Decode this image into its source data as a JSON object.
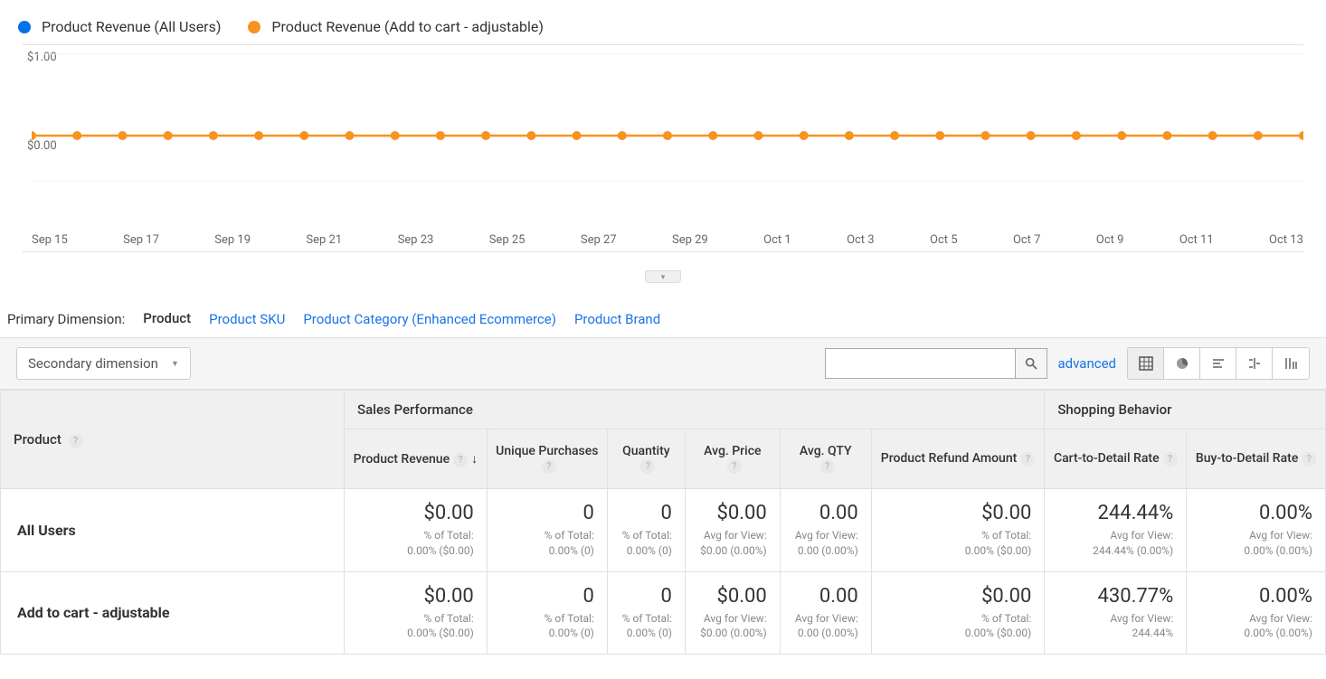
{
  "chart_data": {
    "type": "line",
    "series": [
      {
        "name": "Product Revenue (All Users)",
        "color": "#0073e6",
        "values": [
          0,
          0,
          0,
          0,
          0,
          0,
          0,
          0,
          0,
          0,
          0,
          0,
          0,
          0,
          0,
          0,
          0,
          0,
          0,
          0,
          0,
          0,
          0,
          0,
          0,
          0,
          0,
          0,
          0
        ]
      },
      {
        "name": "Product Revenue (Add to cart - adjustable)",
        "color": "#f7931e",
        "values": [
          0,
          0,
          0,
          0,
          0,
          0,
          0,
          0,
          0,
          0,
          0,
          0,
          0,
          0,
          0,
          0,
          0,
          0,
          0,
          0,
          0,
          0,
          0,
          0,
          0,
          0,
          0,
          0,
          0
        ]
      }
    ],
    "x_ticks": [
      "Sep 15",
      "Sep 17",
      "Sep 19",
      "Sep 21",
      "Sep 23",
      "Sep 25",
      "Sep 27",
      "Sep 29",
      "Oct 1",
      "Oct 3",
      "Oct 5",
      "Oct 7",
      "Oct 9",
      "Oct 11",
      "Oct 13"
    ],
    "y_ticks": [
      "$1.00",
      "$0.00"
    ],
    "ylim": [
      0,
      1
    ]
  },
  "dimension": {
    "label": "Primary Dimension:",
    "active": "Product",
    "links": [
      "Product SKU",
      "Product Category (Enhanced Ecommerce)",
      "Product Brand"
    ]
  },
  "controls": {
    "secondary": "Secondary dimension",
    "advanced": "advanced"
  },
  "table": {
    "product_header": "Product",
    "group1": "Sales Performance",
    "group2": "Shopping Behavior",
    "cols": [
      {
        "label": "Product Revenue",
        "sort": true
      },
      {
        "label": "Unique Purchases"
      },
      {
        "label": "Quantity"
      },
      {
        "label": "Avg. Price"
      },
      {
        "label": "Avg. QTY"
      },
      {
        "label": "Product Refund Amount"
      },
      {
        "label": "Cart-to-Detail Rate"
      },
      {
        "label": "Buy-to-Detail Rate"
      }
    ],
    "rows": [
      {
        "name": "All Users",
        "metrics": [
          {
            "v": "$0.00",
            "s1": "% of Total:",
            "s2": "0.00% ($0.00)"
          },
          {
            "v": "0",
            "s1": "% of Total:",
            "s2": "0.00% (0)"
          },
          {
            "v": "0",
            "s1": "% of Total:",
            "s2": "0.00% (0)"
          },
          {
            "v": "$0.00",
            "s1": "Avg for View:",
            "s2": "$0.00 (0.00%)"
          },
          {
            "v": "0.00",
            "s1": "Avg for View:",
            "s2": "0.00 (0.00%)"
          },
          {
            "v": "$0.00",
            "s1": "% of Total:",
            "s2": "0.00% ($0.00)"
          },
          {
            "v": "244.44%",
            "s1": "Avg for View:",
            "s2": "244.44% (0.00%)"
          },
          {
            "v": "0.00%",
            "s1": "Avg for View:",
            "s2": "0.00% (0.00%)"
          }
        ]
      },
      {
        "name": "Add to cart - adjustable",
        "metrics": [
          {
            "v": "$0.00",
            "s1": "% of Total:",
            "s2": "0.00% ($0.00)"
          },
          {
            "v": "0",
            "s1": "% of Total:",
            "s2": "0.00% (0)"
          },
          {
            "v": "0",
            "s1": "% of Total:",
            "s2": "0.00% (0)"
          },
          {
            "v": "$0.00",
            "s1": "Avg for View:",
            "s2": "$0.00 (0.00%)"
          },
          {
            "v": "0.00",
            "s1": "Avg for View:",
            "s2": "0.00 (0.00%)"
          },
          {
            "v": "$0.00",
            "s1": "% of Total:",
            "s2": "0.00% ($0.00)"
          },
          {
            "v": "430.77%",
            "s1": "Avg for View:",
            "s2": "244.44%"
          },
          {
            "v": "0.00%",
            "s1": "Avg for View:",
            "s2": "0.00% (0.00%)"
          }
        ]
      }
    ]
  }
}
